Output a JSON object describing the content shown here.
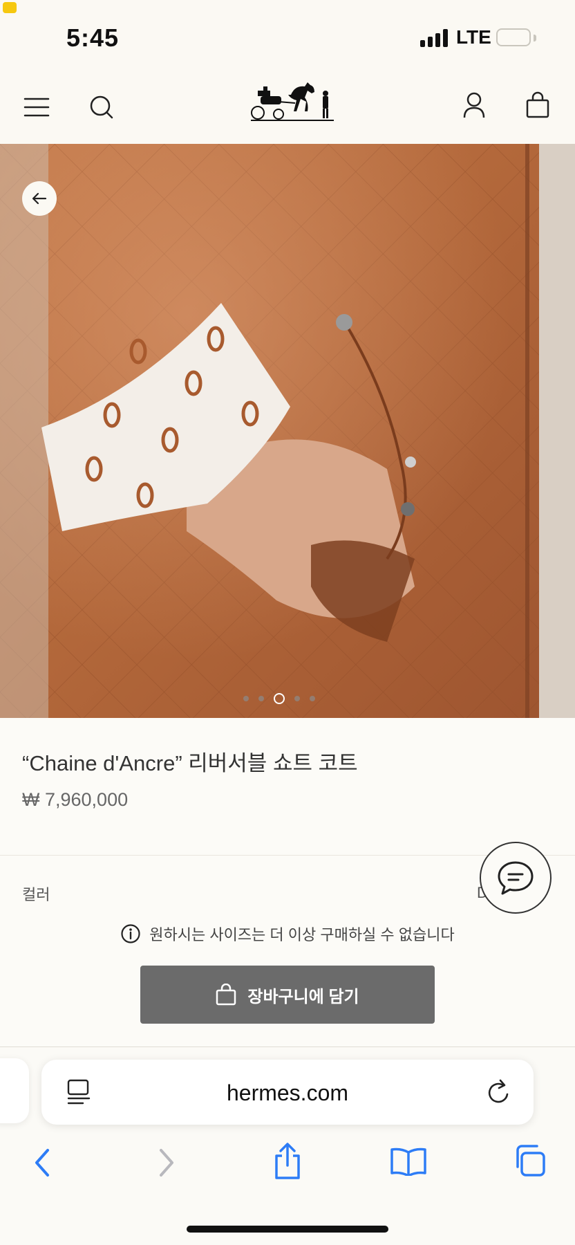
{
  "status_bar": {
    "time": "5:45",
    "network": "LTE"
  },
  "header": {
    "menu_icon": "hamburger-menu-icon",
    "search_icon": "search-icon",
    "logo": "hermes-carriage-logo",
    "account_icon": "user-icon",
    "bag_icon": "shopping-bag-icon"
  },
  "hero": {
    "back_icon": "arrow-left-icon",
    "carousel_total": 5,
    "carousel_active": 3
  },
  "product": {
    "title": "“Chaine d'Ancre” 리버서블 쇼트 코트",
    "price": "₩ 7,960,000",
    "color_label": "컬러",
    "color_value": "D"
  },
  "notice": {
    "text": "원하시는 사이즈는 더 이상 구매하실 수 없습니다"
  },
  "cart_button": {
    "label": "장바구니에 담기"
  },
  "safari": {
    "url": "hermes.com"
  },
  "colors": {
    "accent_blue": "#2d7cf6",
    "button_gray": "#6b6b6b",
    "background": "#fcfbf7"
  }
}
